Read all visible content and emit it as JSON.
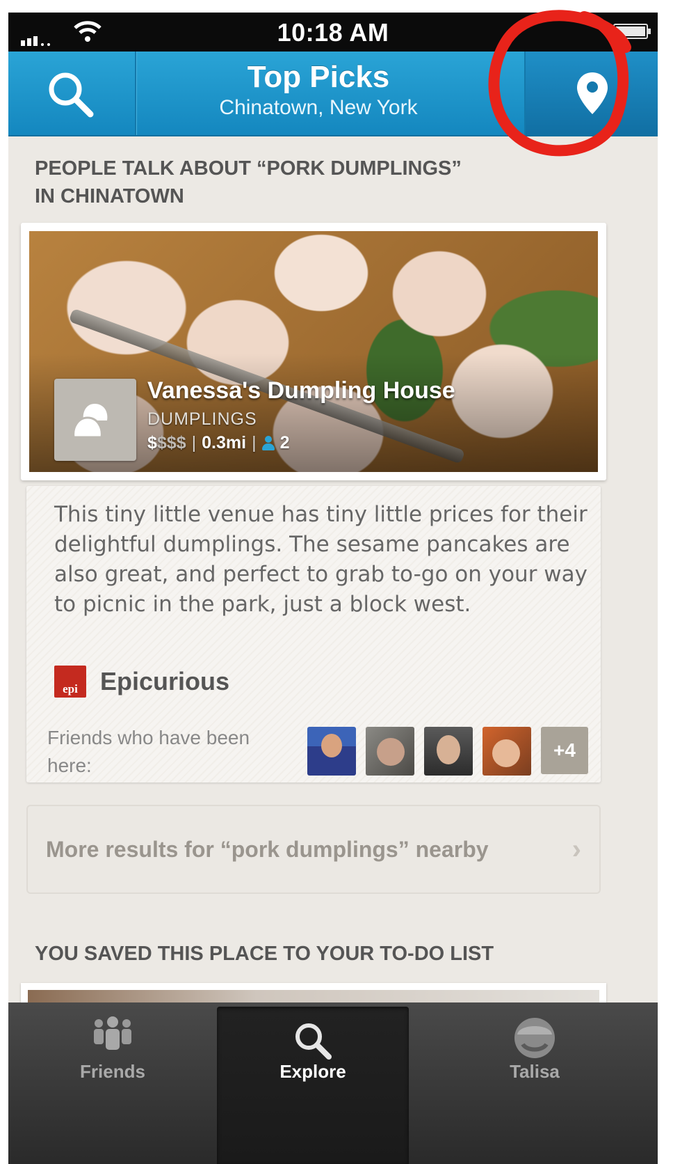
{
  "status_bar": {
    "time": "10:18 AM"
  },
  "header": {
    "title": "Top Picks",
    "subtitle": "Chinatown, New York"
  },
  "section1": {
    "heading_line1": "PEOPLE TALK ABOUT “PORK DUMPLINGS”",
    "heading_line2": "IN CHINATOWN"
  },
  "venue": {
    "name": "Vanessa's Dumpling House",
    "category": "DUMPLINGS",
    "price_active": "$",
    "price_inactive": "$$$",
    "distance": "0.3mi",
    "friends_count": "2",
    "separator": "|"
  },
  "tip": {
    "text": "This tiny little venue has tiny little prices for their delightful dumplings. The sesame pancakes are also great, and perfect to grab to-go on your way to picnic in the park, just a block west.",
    "source_logo_text": "epi",
    "source_name": "Epicurious",
    "friends_label": "Friends who have been here:",
    "more_friends": "+4"
  },
  "more_results": {
    "label": "More results for “pork dumplings” nearby",
    "chevron": "›"
  },
  "section2": {
    "heading": "YOU SAVED THIS PLACE TO YOUR TO-DO LIST"
  },
  "tabs": [
    {
      "label": "Friends",
      "icon": "friends-icon"
    },
    {
      "label": "Explore",
      "icon": "search-icon"
    },
    {
      "label": "Talisa",
      "icon": "avatar-icon"
    }
  ],
  "colors": {
    "header_blue": "#1f96cf",
    "annotation_red": "#e8231a",
    "background": "#ece9e4"
  }
}
